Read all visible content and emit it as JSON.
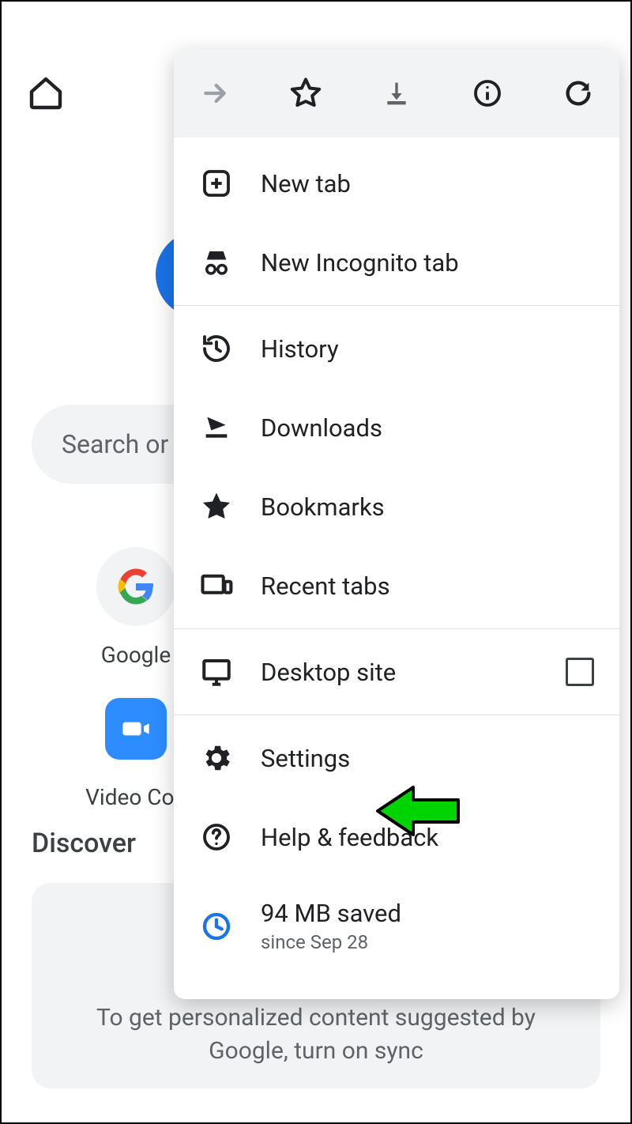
{
  "toolbar": {
    "home": "Home"
  },
  "search": {
    "placeholder": "Search or"
  },
  "shortcuts": [
    {
      "label": "Google"
    },
    {
      "label": "Video Con"
    }
  ],
  "discover_label": "Discover",
  "card_text": "To get personalized content suggested by Google, turn on sync",
  "menu": {
    "items": {
      "new_tab": "New tab",
      "incognito": "New Incognito tab",
      "history": "History",
      "downloads": "Downloads",
      "bookmarks": "Bookmarks",
      "recent_tabs": "Recent tabs",
      "desktop_site": "Desktop site",
      "settings": "Settings",
      "help": "Help & feedback",
      "data_saved": "94 MB saved",
      "data_since": "since Sep 28"
    },
    "desktop_checked": false
  }
}
